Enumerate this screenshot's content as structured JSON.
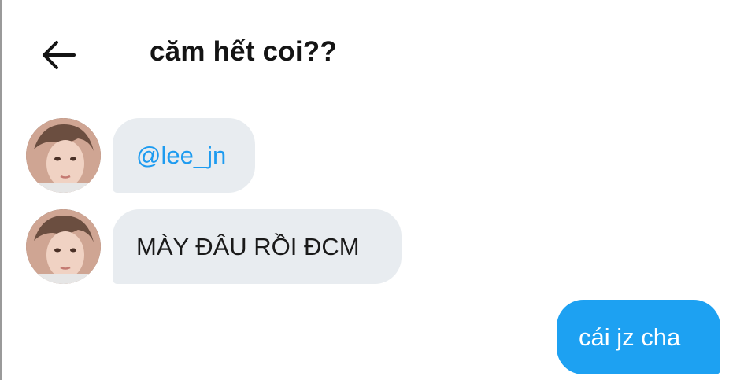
{
  "header": {
    "title": "căm hết coi??",
    "back_icon": "arrow-left-icon"
  },
  "messages": [
    {
      "direction": "incoming",
      "text": "@lee_jn",
      "type": "mention"
    },
    {
      "direction": "incoming",
      "text": "MÀY ĐÂU RỒI ĐCM",
      "type": "text"
    },
    {
      "direction": "outgoing",
      "text": "cái jz cha",
      "type": "text"
    }
  ],
  "colors": {
    "incoming_bubble": "#e8ecf0",
    "outgoing_bubble": "#1da1f2",
    "mention": "#1d9bf0",
    "title": "#141414"
  }
}
